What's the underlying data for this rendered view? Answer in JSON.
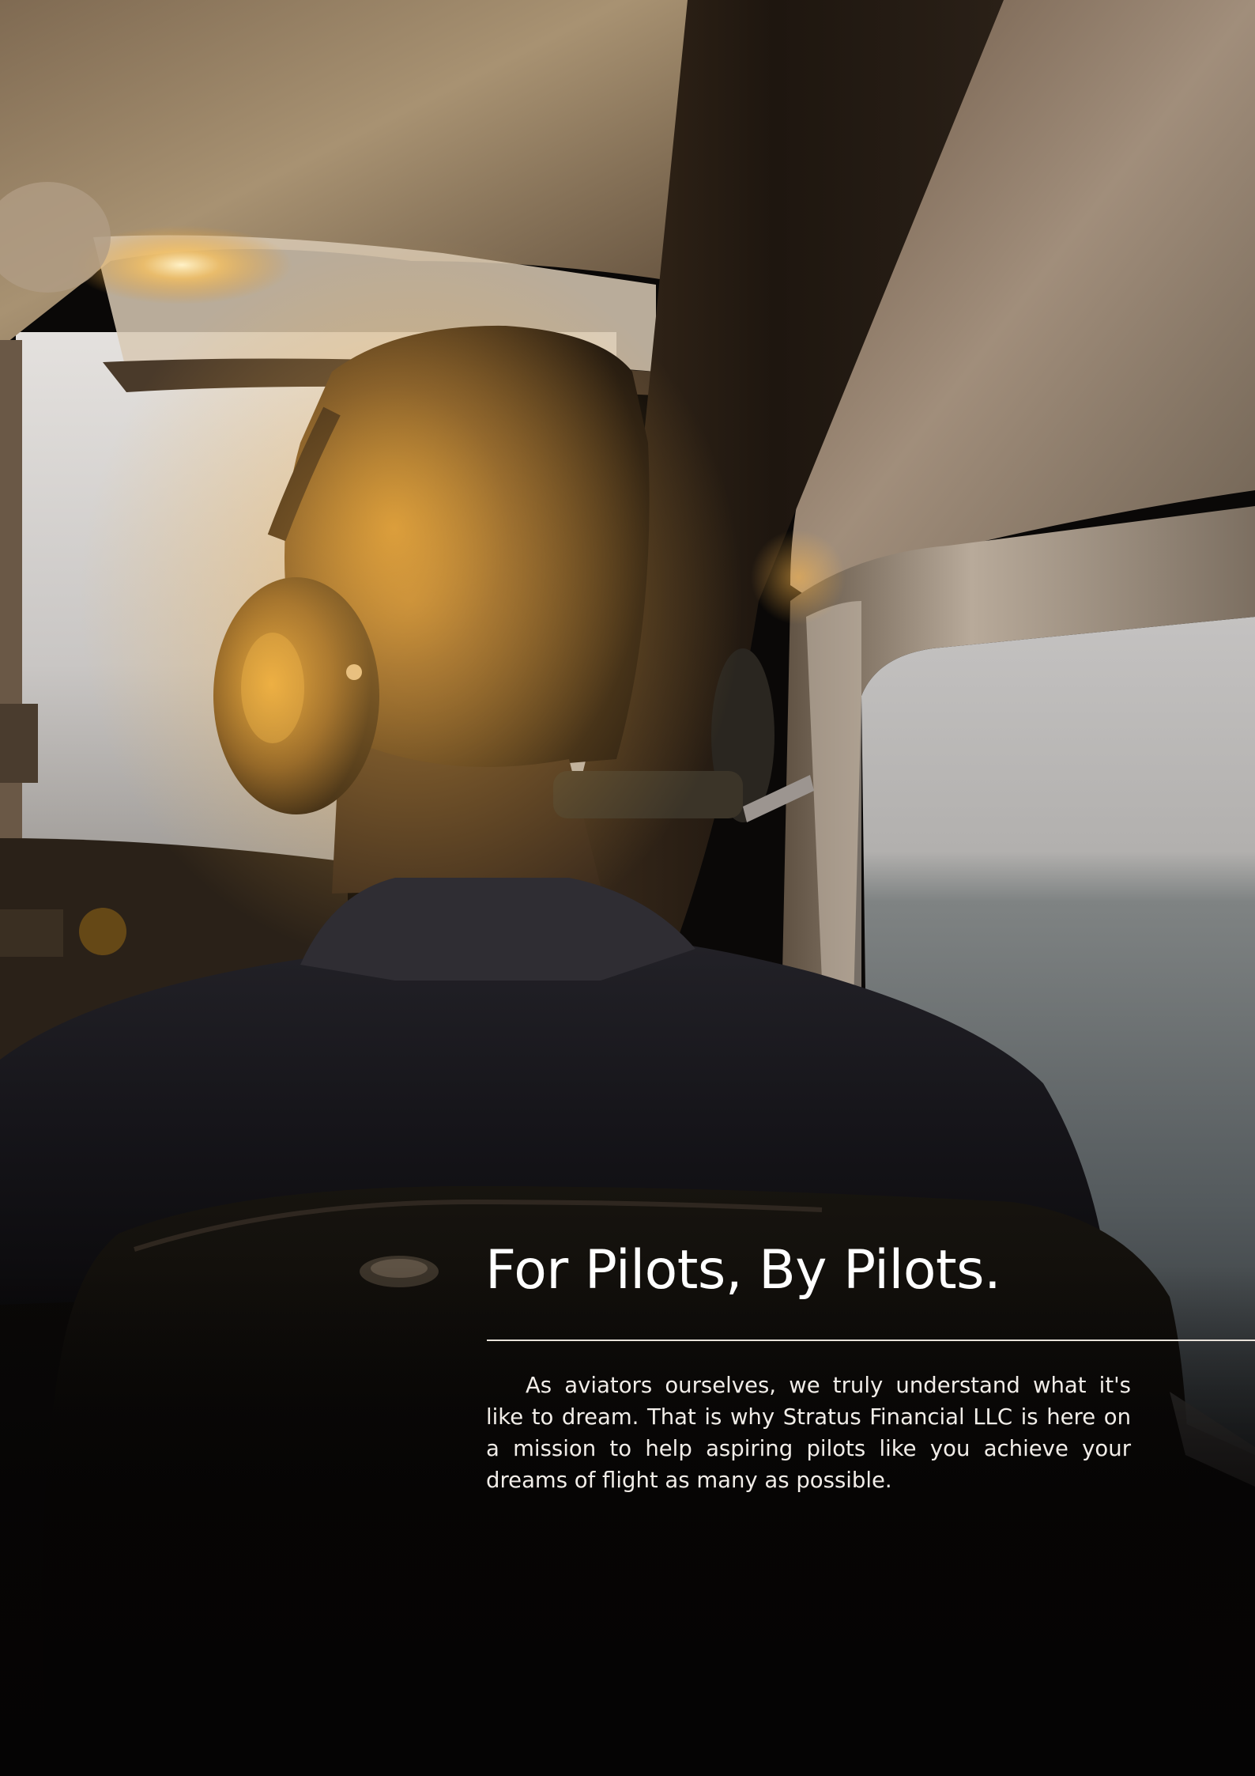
{
  "hero": {
    "title": "For Pilots, By Pilots.",
    "body": "As aviators ourselves, we truly understand what it's like to dream. That is why Stratus Financial LLC is here on a mission to help aspiring pilots like you achieve your dreams of flight as many as possible."
  },
  "colors": {
    "background": "#050404",
    "sky": "#c8c6c4",
    "sun_glow": "#f0b030",
    "text": "#ffffff"
  }
}
